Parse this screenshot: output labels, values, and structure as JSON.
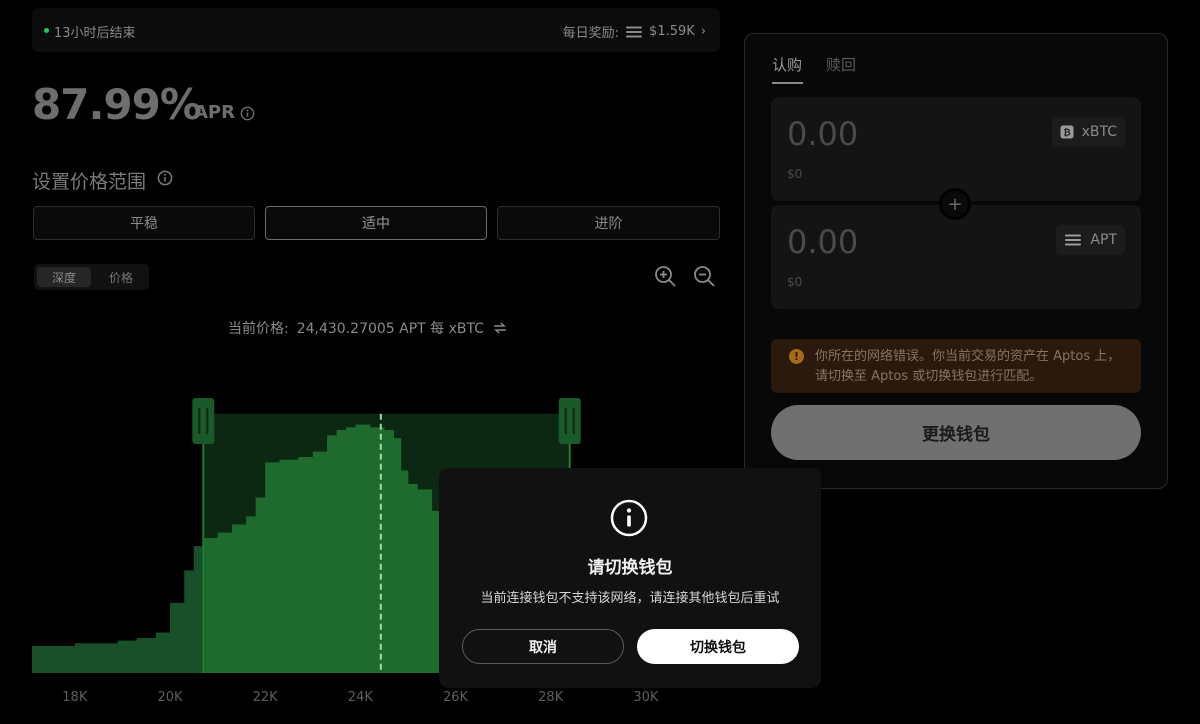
{
  "banner": {
    "status_text": "13小时后结束",
    "reward_label": "每日奖励:",
    "reward_value": "$1.59K",
    "reward_chevron": "›"
  },
  "apr": {
    "value": "87.99%",
    "label": "APR"
  },
  "range": {
    "title": "设置价格范围",
    "options": [
      "平稳",
      "适中",
      "进阶"
    ],
    "selected": "适中"
  },
  "view_toggle": {
    "options": [
      "深度",
      "价格"
    ],
    "selected": "深度"
  },
  "current_price": {
    "label": "当前价格:",
    "value": "24,430.27005 APT 每 xBTC"
  },
  "chart_data": {
    "type": "bar",
    "x_tick_labels": [
      "18K",
      "20K",
      "22K",
      "24K",
      "26K",
      "28K",
      "30K"
    ],
    "x_ticks": [
      18000,
      20000,
      22000,
      24000,
      26000,
      28000,
      30000
    ],
    "xlim": [
      17100,
      31600
    ],
    "current_price": 24430.27,
    "range": [
      20700,
      28400
    ],
    "bars": [
      [
        17100,
        18000,
        0.1
      ],
      [
        18000,
        18900,
        0.11
      ],
      [
        18900,
        19300,
        0.12
      ],
      [
        19300,
        19700,
        0.13
      ],
      [
        19700,
        20000,
        0.15
      ],
      [
        20000,
        20300,
        0.26
      ],
      [
        20300,
        20500,
        0.38
      ],
      [
        20500,
        20700,
        0.47
      ],
      [
        20700,
        21000,
        0.5
      ],
      [
        21000,
        21300,
        0.52
      ],
      [
        21300,
        21600,
        0.55
      ],
      [
        21600,
        21800,
        0.58
      ],
      [
        21800,
        22000,
        0.65
      ],
      [
        22000,
        22300,
        0.78
      ],
      [
        22300,
        22700,
        0.79
      ],
      [
        22700,
        23000,
        0.8
      ],
      [
        23000,
        23300,
        0.82
      ],
      [
        23300,
        23500,
        0.88
      ],
      [
        23500,
        23700,
        0.9
      ],
      [
        23700,
        23900,
        0.91
      ],
      [
        23900,
        24200,
        0.92
      ],
      [
        24200,
        24500,
        0.91
      ],
      [
        24500,
        24700,
        0.9
      ],
      [
        24700,
        24850,
        0.87
      ],
      [
        24850,
        25000,
        0.75
      ],
      [
        25000,
        25200,
        0.7
      ],
      [
        25200,
        25500,
        0.68
      ],
      [
        25500,
        25800,
        0.6
      ],
      [
        25800,
        26200,
        0.56
      ],
      [
        26200,
        26600,
        0.48
      ],
      [
        26600,
        27000,
        0.42
      ],
      [
        27000,
        27400,
        0.37
      ],
      [
        27400,
        27800,
        0.32
      ],
      [
        27800,
        28200,
        0.27
      ],
      [
        28200,
        28400,
        0.23
      ]
    ]
  },
  "panel": {
    "tabs": [
      "认购",
      "赎回"
    ],
    "active_tab": "认购",
    "inputs": [
      {
        "amount": "0.00",
        "usd": "$0",
        "token": "xBTC",
        "icon": "bitcoin-icon"
      },
      {
        "amount": "0.00",
        "usd": "$0",
        "token": "APT",
        "icon": "aptos-icon"
      }
    ],
    "plus": "+",
    "warning": "你所在的网络错误。你当前交易的资产在 Aptos 上，请切换至 Aptos 或切换钱包进行匹配。",
    "action": "更换钱包"
  },
  "modal": {
    "title": "请切换钱包",
    "message": "当前连接钱包不支持该网络，请连接其他钱包后重试",
    "cancel": "取消",
    "confirm": "切换钱包"
  },
  "colors": {
    "accent_green": "#1f6b2e",
    "range_band": "#0c2712",
    "warning_bg": "#2a1a0e"
  }
}
